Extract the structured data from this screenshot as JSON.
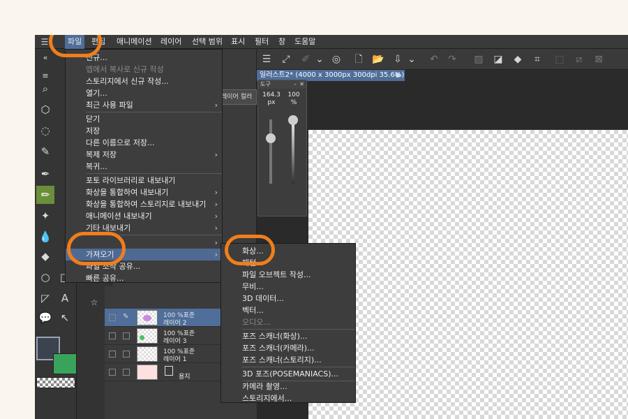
{
  "menubar": {
    "items": [
      "파일",
      "편집",
      "애니메이션",
      "레이어",
      "선택 범위",
      "표시",
      "필터",
      "창",
      "도움말"
    ]
  },
  "file_menu": {
    "items": [
      {
        "label": "신규...",
        "disabled": false,
        "submenu": false
      },
      {
        "label": "엡에서 복사로 신규 작성",
        "disabled": true,
        "submenu": false
      },
      {
        "label": "스토리지에서 신규 작성...",
        "disabled": false,
        "submenu": false
      },
      {
        "label": "열기...",
        "disabled": false,
        "submenu": false
      },
      {
        "label": "최근 사용 파일",
        "disabled": false,
        "submenu": true
      },
      {
        "label": "닫기",
        "disabled": false,
        "submenu": false
      },
      {
        "label": "저장",
        "disabled": false,
        "submenu": false
      },
      {
        "label": "다른 이름으로 저장...",
        "disabled": false,
        "submenu": false
      },
      {
        "label": "복제 저장",
        "disabled": false,
        "submenu": true
      },
      {
        "label": "복귀...",
        "disabled": false,
        "submenu": false
      },
      {
        "label": "포토 라이브러리로 내보내기",
        "disabled": false,
        "submenu": false
      },
      {
        "label": "화상을 통합하여 내보내기",
        "disabled": false,
        "submenu": true
      },
      {
        "label": "화상을 통합하여 스토리지로 내보내기",
        "disabled": false,
        "submenu": true
      },
      {
        "label": "애니메이션 내보내기",
        "disabled": false,
        "submenu": true
      },
      {
        "label": "기타 내보내기",
        "disabled": false,
        "submenu": true
      },
      {
        "label": "가져오기",
        "disabled": false,
        "submenu": true
      },
      {
        "label": "파일 조작 공유...",
        "disabled": false,
        "submenu": false
      },
      {
        "label": "빠른 공유...",
        "disabled": false,
        "submenu": false
      }
    ]
  },
  "import_submenu": {
    "items": [
      {
        "label": "화상...",
        "disabled": false
      },
      {
        "label": "패턴...",
        "disabled": false
      },
      {
        "label": "파일 오브젝트 작성...",
        "disabled": false
      },
      {
        "label": "무비...",
        "disabled": false
      },
      {
        "label": "3D 데이터...",
        "disabled": false
      },
      {
        "label": "벡터...",
        "disabled": false
      },
      {
        "label": "오디오...",
        "disabled": true
      },
      {
        "label": "포즈 스캐너(화상)...",
        "disabled": false
      },
      {
        "label": "포즈 스캐너(카메라)...",
        "disabled": false
      },
      {
        "label": "포즈 스캐너(스토리지)...",
        "disabled": false
      },
      {
        "label": "3D 포즈(POSEMANIACS)...",
        "disabled": false
      },
      {
        "label": "카메라 촬영...",
        "disabled": false
      },
      {
        "label": "스토리지에서...",
        "disabled": false
      }
    ]
  },
  "document_tab": {
    "title": "일러스트2* (4000 x 3000px 300dpi 35.6%)"
  },
  "tool_property_panel": {
    "title": "도구",
    "brush_size": "164.3",
    "brush_size_unit": "px",
    "opacity": "100",
    "opacity_unit": "%"
  },
  "layer_color_tab": "레이어 컬러",
  "layers": [
    {
      "blend": "100 %표준",
      "name": "레이어 2",
      "selected": true
    },
    {
      "blend": "100 %표준",
      "name": "레이어 3",
      "selected": false
    },
    {
      "blend": "100 %표준",
      "name": "레이어 1",
      "selected": false
    },
    {
      "blend": "",
      "name": "용지",
      "selected": false
    }
  ],
  "colors": {
    "highlight": "#4e6a93",
    "callout": "#f07e1c",
    "main_color": "#3b4250",
    "sub_color": "#3aa35b",
    "paper_thumb": "#fde0e0"
  }
}
